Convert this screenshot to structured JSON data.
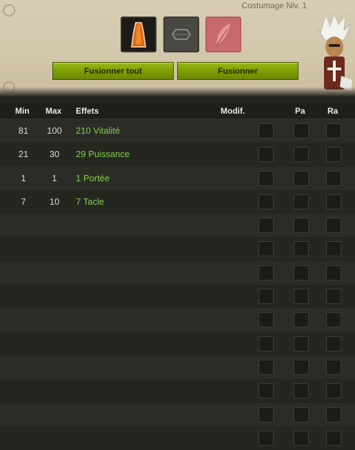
{
  "header": {
    "title": "Costumage Niv. 1"
  },
  "buttons": {
    "merge_all": "Fusionner tout",
    "merge": "Fusionner"
  },
  "columns": {
    "min": "Min",
    "max": "Max",
    "effects": "Effets",
    "modif": "Modif.",
    "pa": "Pa",
    "ra": "Ra"
  },
  "effects": [
    {
      "min": "81",
      "max": "100",
      "effect": "210 Vitalité"
    },
    {
      "min": "21",
      "max": "30",
      "effect": "29 Puissance"
    },
    {
      "min": "1",
      "max": "1",
      "effect": "1 Portée"
    },
    {
      "min": "7",
      "max": "10",
      "effect": "7 Tacle"
    },
    {
      "min": "",
      "max": "",
      "effect": ""
    },
    {
      "min": "",
      "max": "",
      "effect": ""
    },
    {
      "min": "",
      "max": "",
      "effect": ""
    },
    {
      "min": "",
      "max": "",
      "effect": ""
    },
    {
      "min": "",
      "max": "",
      "effect": ""
    },
    {
      "min": "",
      "max": "",
      "effect": ""
    },
    {
      "min": "",
      "max": "",
      "effect": ""
    },
    {
      "min": "",
      "max": "",
      "effect": ""
    },
    {
      "min": "",
      "max": "",
      "effect": ""
    },
    {
      "min": "",
      "max": "",
      "effect": ""
    }
  ],
  "colors": {
    "effect_text": "#7ed04a",
    "button": "#8aaa0b",
    "panel": "#d5c9ae"
  }
}
